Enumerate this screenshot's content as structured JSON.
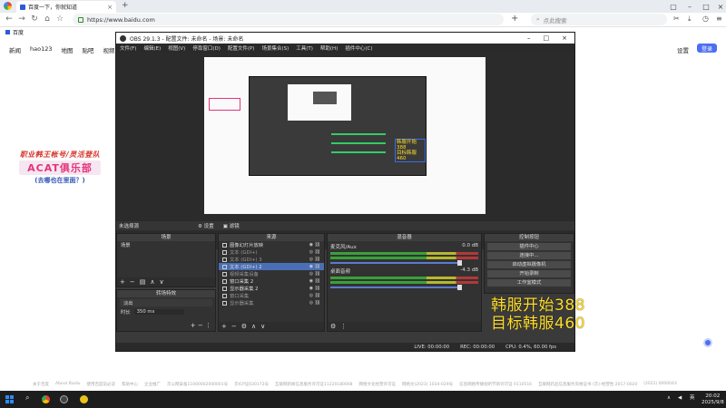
{
  "browser": {
    "tab_title": "百度一下，你就知道",
    "url": "https://www.baidu.com",
    "search_placeholder": "点此搜索",
    "bookmark": "百度"
  },
  "baidu": {
    "nav": [
      "新闻",
      "hao123",
      "地图",
      "贴吧",
      "视频",
      "图"
    ],
    "settings": "设置",
    "login": "登录",
    "promo": {
      "line1": "职业韩王帐号/灵活登队",
      "line2": "ACAT俱乐部",
      "line3": "(去哪也在里面？)"
    },
    "footer": [
      "关于百度",
      "About Baidu",
      "使用百度前必读",
      "帮助中心",
      "企业推广",
      "京公网安备11000002000001号",
      "京ICP证030173号",
      "互联网新闻信息服务许可证11220180008",
      "网络文化经营许可证",
      "网络文(2023) 1034-029号",
      "信息网络传播视听节目许可证 0110516",
      "互联网药品信息服务资格证书 (京)-经营性-2017-0020",
      "(2022) 0000043"
    ]
  },
  "obs": {
    "title": "OBS 29.1.3 - 配置文件: 未命名 - 场景: 未命名",
    "menu": [
      "文件(F)",
      "编辑(E)",
      "视图(V)",
      "停靠窗口(D)",
      "配置文件(P)",
      "场景集合(S)",
      "工具(T)",
      "帮助(H)",
      "插件中心(C)"
    ],
    "no_source": "未选择源",
    "tabs": [
      "⚙ 设置",
      "▣ 滤镜"
    ],
    "scenes_header": "场景",
    "scenes": [
      "场景"
    ],
    "transitions_header": "转场特效",
    "transition_type": "淡出",
    "duration_label": "时长",
    "duration_value": "350 ms",
    "sources_header": "来源",
    "sources": [
      "图像幻灯片放映",
      "文本 (GDI+)",
      "文本 (GDI+) 3",
      "文本 (GDI+) 2",
      "视频采集设备",
      "窗口采集 2",
      "显示器采集 2",
      "窗口采集",
      "显示器采集"
    ],
    "mixer_header": "混音器",
    "mixer": [
      {
        "name": "麦克风/Aux",
        "db": "0.0 dB"
      },
      {
        "name": "桌面音频",
        "db": "-4.3 dB"
      }
    ],
    "controls_header": "控制按钮",
    "controls": [
      "插件中心",
      "连接中...",
      "启动虚拟摄像机",
      "开始录制",
      "工作室模式"
    ],
    "overlay": {
      "line1": "韩服开始388",
      "line2": "目标韩服460"
    },
    "status": {
      "live": "LIVE: 00:00:00",
      "rec": "REC: 00:00:00",
      "cpu": "CPU: 0.4%, 60.00 fps"
    }
  },
  "taskbar": {
    "time": "20:02",
    "date": "2025/9/8",
    "lang": "英"
  }
}
